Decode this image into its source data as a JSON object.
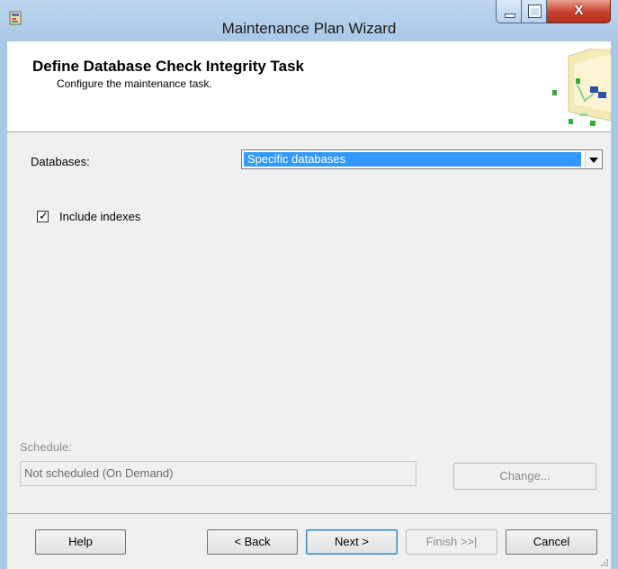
{
  "window": {
    "title": "Maintenance Plan Wizard",
    "close_glyph": "X"
  },
  "header": {
    "title": "Define Database Check Integrity Task",
    "subtitle": "Configure the maintenance task."
  },
  "databases": {
    "label": "Databases:",
    "value": "Specific databases"
  },
  "include_indexes": {
    "label": "Include indexes",
    "checked": true
  },
  "schedule": {
    "label": "Schedule:",
    "value": "Not scheduled (On Demand)",
    "change_label": "Change..."
  },
  "footer": {
    "help_label": "Help",
    "back_label": "< Back",
    "next_label": "Next >",
    "finish_label": "Finish >>|",
    "cancel_label": "Cancel"
  },
  "icons": {
    "app": "wizard-app-icon",
    "header": "task-graphic-icon"
  },
  "colors": {
    "selection": "#3399ff",
    "close_button": "#c7402d",
    "frame": "#a8c8e8"
  }
}
